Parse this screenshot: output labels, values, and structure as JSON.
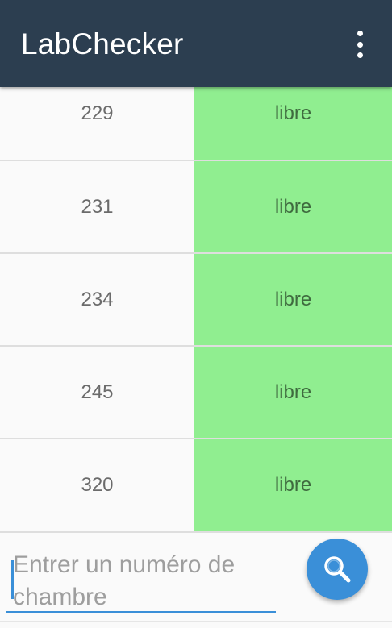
{
  "toolbar": {
    "title": "LabChecker",
    "menu_icon": "overflow-menu-icon",
    "background": "#2c3e50"
  },
  "rooms": [
    {
      "number": "229",
      "status": "libre"
    },
    {
      "number": "231",
      "status": "libre"
    },
    {
      "number": "234",
      "status": "libre"
    },
    {
      "number": "245",
      "status": "libre"
    },
    {
      "number": "320",
      "status": "libre"
    }
  ],
  "colors": {
    "status_free": "#90ee90",
    "accent": "#3a8fd8"
  },
  "search": {
    "placeholder": "Entrer un numéro de chambre",
    "value": "",
    "button_icon": "search-icon"
  }
}
